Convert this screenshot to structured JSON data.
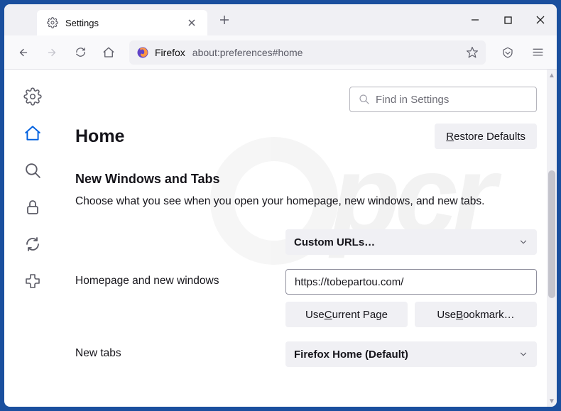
{
  "titlebar": {
    "tab_label": "Settings",
    "new_tab": "+"
  },
  "toolbar": {
    "url_prefix": "Firefox",
    "url": "about:preferences#home"
  },
  "search": {
    "placeholder": "Find in Settings"
  },
  "heading": {
    "title": "Home",
    "restore_btn": "Restore Defaults",
    "restore_mnemonic": "R"
  },
  "section": {
    "title": "New Windows and Tabs",
    "desc": "Choose what you see when you open your homepage, new windows, and new tabs."
  },
  "rows": {
    "homepage_label": "Homepage and new windows",
    "homepage_select": "Custom URLs…",
    "homepage_url": "https://tobepartou.com/",
    "use_current": "Use Current Page",
    "use_current_mnemonic": "C",
    "use_bookmark": "Use Bookmark…",
    "use_bookmark_mnemonic": "B",
    "newtabs_label": "New tabs",
    "newtabs_select": "Firefox Home (Default)"
  }
}
